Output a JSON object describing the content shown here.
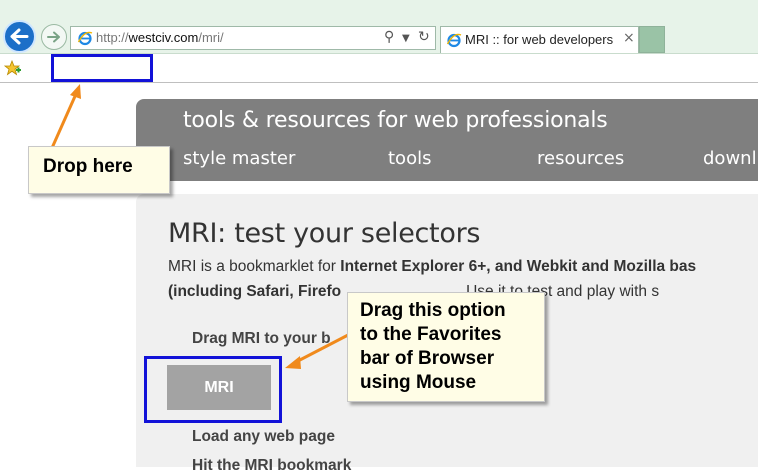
{
  "browser": {
    "url_prefix": "http://",
    "url_domain": "westciv.com",
    "url_path": "/mri/",
    "tab_title": "MRI :: for web developers",
    "tab_close": "×"
  },
  "header": {
    "title": "tools & resources for web professionals",
    "nav": [
      "style master",
      "tools",
      "resources",
      "downl"
    ]
  },
  "content": {
    "title": "MRI: test your selectors",
    "intro_1_a": "MRI is a bookmarklet for ",
    "intro_1_b": "Internet Explorer 6+, and Webkit and Mozilla bas",
    "intro_2_a": "(including Safari, Firefo",
    "intro_2_b": "Use it to test and play with s",
    "step_1": "Drag MRI to your b",
    "mri_button": "MRI",
    "step_2": "Load any web page",
    "step_3": "Hit the MRI bookmark"
  },
  "callouts": {
    "drop_here": "Drop here",
    "drag_line_1": "Drag this option",
    "drag_line_2": "to the Favorites",
    "drag_line_3": "bar of Browser",
    "drag_line_4": "using Mouse"
  },
  "colors": {
    "highlight_box": "#1212d8",
    "arrow": "#f08a1c",
    "callout_bg": "#fffde6",
    "header_bg": "#7f7f7f"
  }
}
